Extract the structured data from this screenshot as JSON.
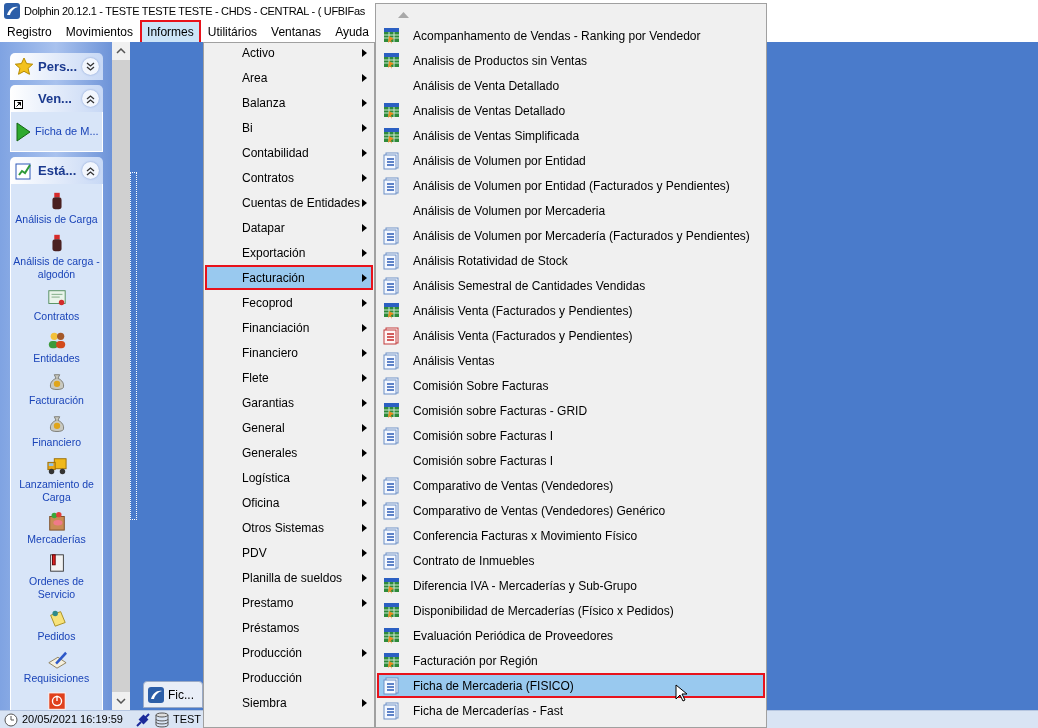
{
  "window": {
    "title": "Dolphin 20.12.1 - TESTE TESTE TESTE - CHDS - CENTRAL -  ( UFBIFas"
  },
  "menubar": [
    {
      "label": "Registro",
      "selected": false
    },
    {
      "label": "Movimientos",
      "selected": false
    },
    {
      "label": "Informes",
      "selected": true
    },
    {
      "label": "Utilitários",
      "selected": false
    },
    {
      "label": "Ventanas",
      "selected": false
    },
    {
      "label": "Ayuda",
      "selected": false
    }
  ],
  "sidebar": {
    "panels": [
      {
        "title": "Pers...",
        "kind": "star",
        "expanded": false
      },
      {
        "title": "Ven...",
        "kind": "shortcut",
        "expanded": true,
        "items": [
          {
            "label": "Ficha de M...",
            "kind": "play"
          }
        ]
      },
      {
        "title": "Está...",
        "kind": "chart",
        "expanded": true,
        "items": [
          {
            "label": "Análisis de Carga",
            "kind": "bottle"
          },
          {
            "label": "Análisis de carga - algodón",
            "kind": "bottle"
          },
          {
            "label": "Contratos",
            "kind": "certificate"
          },
          {
            "label": "Entidades",
            "kind": "people"
          },
          {
            "label": "Facturación",
            "kind": "moneybag"
          },
          {
            "label": "Financiero",
            "kind": "moneybag"
          },
          {
            "label": "Lanzamiento de Carga",
            "kind": "truck"
          },
          {
            "label": "Mercaderías",
            "kind": "bag"
          },
          {
            "label": "Ordenes de Servicio",
            "kind": "document"
          },
          {
            "label": "Pedidos",
            "kind": "note"
          },
          {
            "label": "Requisiciones",
            "kind": "pen"
          },
          {
            "kind": "power"
          }
        ]
      }
    ]
  },
  "taskbar": {
    "label": "Fic..."
  },
  "status_bar": {
    "datetime": "20/05/2021 16:19:59",
    "database": "TEST"
  },
  "informes_menu": {
    "items": [
      {
        "label": "Activo",
        "submenu": true,
        "selected": false
      },
      {
        "label": "Area",
        "submenu": true,
        "selected": false
      },
      {
        "label": "Balanza",
        "submenu": true,
        "selected": false
      },
      {
        "label": "Bi",
        "submenu": true,
        "selected": false
      },
      {
        "label": "Contabilidad",
        "submenu": true,
        "selected": false
      },
      {
        "label": "Contratos",
        "submenu": true,
        "selected": false
      },
      {
        "label": "Cuentas de Entidades",
        "submenu": true,
        "selected": false
      },
      {
        "label": "Datapar",
        "submenu": true,
        "selected": false
      },
      {
        "label": "Exportación",
        "submenu": true,
        "selected": false
      },
      {
        "label": "Facturación",
        "submenu": true,
        "selected": true
      },
      {
        "label": "Fecoprod",
        "submenu": true,
        "selected": false
      },
      {
        "label": "Financiación",
        "submenu": true,
        "selected": false
      },
      {
        "label": "Financiero",
        "submenu": true,
        "selected": false
      },
      {
        "label": "Flete",
        "submenu": true,
        "selected": false
      },
      {
        "label": "Garantias",
        "submenu": true,
        "selected": false
      },
      {
        "label": "General",
        "submenu": true,
        "selected": false
      },
      {
        "label": "Generales",
        "submenu": true,
        "selected": false
      },
      {
        "label": "Logística",
        "submenu": true,
        "selected": false
      },
      {
        "label": "Oficina",
        "submenu": true,
        "selected": false
      },
      {
        "label": "Otros Sistemas",
        "submenu": true,
        "selected": false
      },
      {
        "label": "PDV",
        "submenu": true,
        "selected": false
      },
      {
        "label": "Planilla de sueldos",
        "submenu": true,
        "selected": false
      },
      {
        "label": "Prestamo",
        "submenu": true,
        "selected": false
      },
      {
        "label": "Préstamos",
        "submenu": false,
        "selected": false
      },
      {
        "label": "Producción",
        "submenu": true,
        "selected": false
      },
      {
        "label": "Producción",
        "submenu": false,
        "selected": false
      },
      {
        "label": "Siembra",
        "submenu": true,
        "selected": false
      }
    ]
  },
  "facturacion_menu": {
    "items": [
      {
        "label": "Acompanhamento de Vendas - Ranking por Vendedor",
        "kind": "grid",
        "selected": false
      },
      {
        "label": "Analisis de Productos sin Ventas",
        "kind": "grid",
        "selected": false
      },
      {
        "label": "Análisis de Venta Detallado",
        "kind": "plain",
        "selected": false
      },
      {
        "label": "Analisis de Ventas Detallado",
        "kind": "grid",
        "selected": false
      },
      {
        "label": "Análisis de Ventas Simplificada",
        "kind": "grid",
        "selected": false
      },
      {
        "label": "Análisis de Volumen por Entidad",
        "kind": "report",
        "selected": false
      },
      {
        "label": "Análisis de Volumen por Entidad (Facturados y Pendientes)",
        "kind": "report",
        "selected": false
      },
      {
        "label": "Análisis de Volumen por Mercaderia",
        "kind": "plain",
        "selected": false
      },
      {
        "label": "Análisis de Volumen por Mercadería (Facturados y Pendientes)",
        "kind": "report",
        "selected": false
      },
      {
        "label": "Análisis Rotatividad de Stock",
        "kind": "report",
        "selected": false
      },
      {
        "label": "Análisis Semestral de Cantidades Vendidas",
        "kind": "report",
        "selected": false
      },
      {
        "label": "Análisis Venta (Facturados y Pendientes)",
        "kind": "grid",
        "selected": false
      },
      {
        "label": "Análisis Venta (Facturados y Pendientes)",
        "kind": "redreport",
        "selected": false
      },
      {
        "label": "Análisis Ventas",
        "kind": "report",
        "selected": false
      },
      {
        "label": "Comisión Sobre Facturas",
        "kind": "report",
        "selected": false
      },
      {
        "label": "Comisión sobre Facturas - GRID",
        "kind": "grid",
        "selected": false
      },
      {
        "label": "Comisión sobre Facturas I",
        "kind": "report",
        "selected": false
      },
      {
        "label": "Comisión sobre Facturas I",
        "kind": "plain",
        "selected": false
      },
      {
        "label": "Comparativo de Ventas (Vendedores)",
        "kind": "report",
        "selected": false
      },
      {
        "label": "Comparativo de Ventas (Vendedores) Genérico",
        "kind": "report",
        "selected": false
      },
      {
        "label": "Conferencia Facturas x Movimiento Físico",
        "kind": "report",
        "selected": false
      },
      {
        "label": "Contrato de Inmuebles",
        "kind": "report",
        "selected": false
      },
      {
        "label": "Diferencia IVA - Mercaderías y Sub-Grupo",
        "kind": "grid",
        "selected": false
      },
      {
        "label": "Disponibilidad de Mercaderías (Físico x Pedidos)",
        "kind": "grid",
        "selected": false
      },
      {
        "label": "Evaluación Periódica de Proveedores",
        "kind": "grid",
        "selected": false
      },
      {
        "label": "Facturación por Región",
        "kind": "grid",
        "selected": false
      },
      {
        "label": "Ficha de Mercaderia (FISICO)",
        "kind": "report",
        "selected": true
      },
      {
        "label": "Ficha de Mercaderías - Fast",
        "kind": "report",
        "selected": false
      }
    ]
  }
}
